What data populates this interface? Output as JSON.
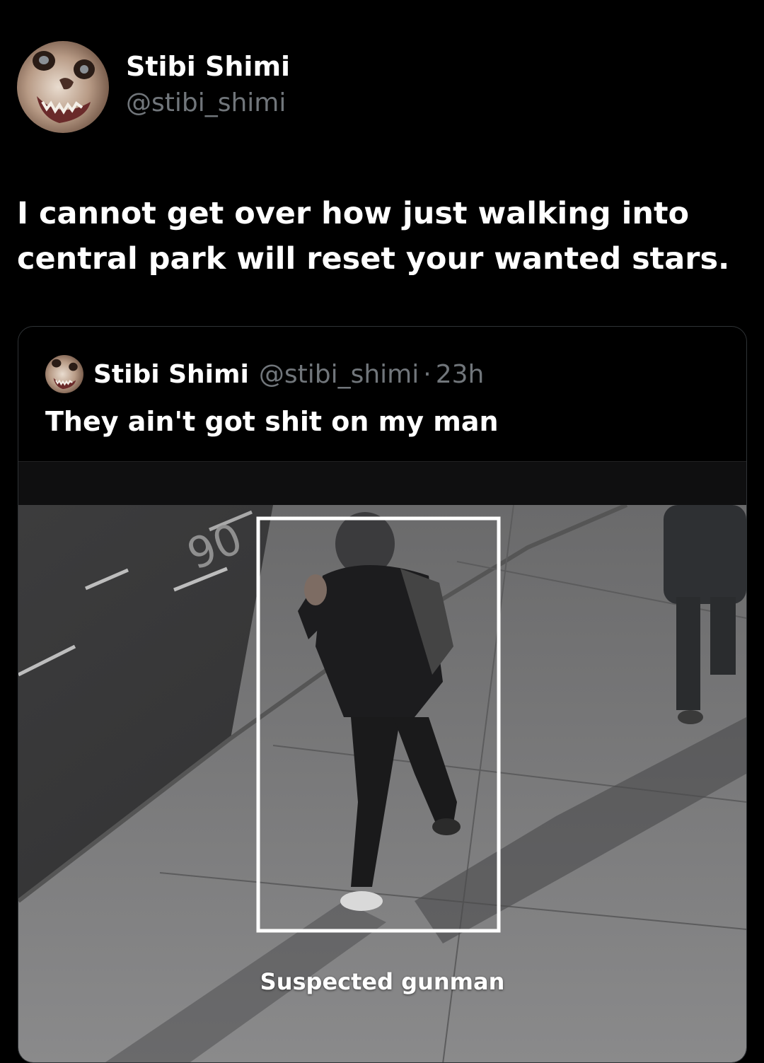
{
  "tweet": {
    "display_name": "Stibi Shimi",
    "handle": "@stibi_shimi",
    "text": "I cannot get over how just walking into central park will reset your wanted stars."
  },
  "quoted_tweet": {
    "display_name": "Stibi Shimi",
    "handle": "@stibi_shimi",
    "separator": "·",
    "time": "23h",
    "text": "They ain't got shit on my man",
    "media_caption": "Suspected gunman"
  }
}
